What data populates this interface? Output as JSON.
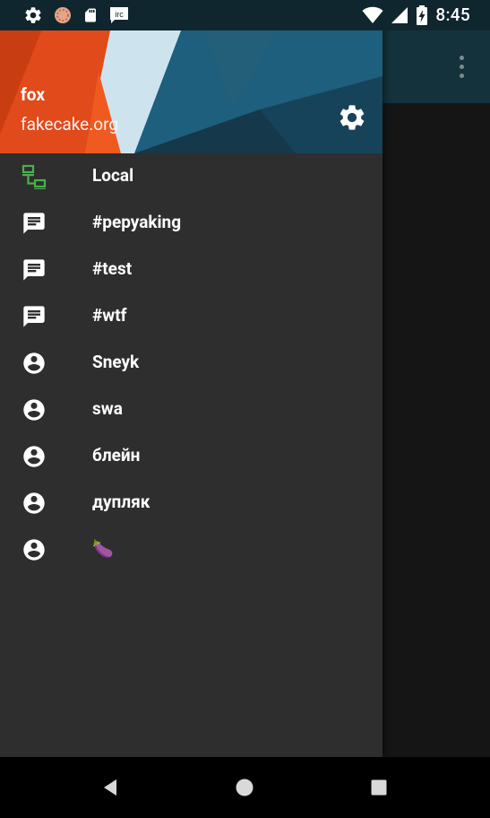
{
  "status_bar": {
    "time": "8:45",
    "left_icons": [
      "gear-icon",
      "hexchat-icon",
      "sd-card-icon",
      "irc-icon"
    ],
    "right_icons": [
      "wifi-icon",
      "cell-signal-icon",
      "battery-charging-icon"
    ],
    "irc_badge": "irc"
  },
  "drawer": {
    "header": {
      "nick": "fox",
      "server": "fakecake.org"
    },
    "items": [
      {
        "label": "Local",
        "icon": "server-network-icon"
      },
      {
        "label": "#pepyaking",
        "icon": "chat-icon"
      },
      {
        "label": "#test",
        "icon": "chat-icon"
      },
      {
        "label": "#wtf",
        "icon": "chat-icon"
      },
      {
        "label": "Sneyk",
        "icon": "account-circle-icon"
      },
      {
        "label": "swa",
        "icon": "account-circle-icon"
      },
      {
        "label": "блейн",
        "icon": "account-circle-icon"
      },
      {
        "label": "дупляк",
        "icon": "account-circle-icon"
      },
      {
        "label": "🍆",
        "icon": "account-circle-icon"
      }
    ]
  },
  "colors": {
    "status_bar": "#10262e",
    "toolbar": "#14323b",
    "drawer_bg": "#2e2e2e",
    "server_icon": "#4caf50",
    "orange": "#e14a1a",
    "pale_blue": "#cde4ef",
    "teal": "#1d5f7c"
  },
  "nav_bar": {
    "buttons": [
      "back-icon",
      "home-icon",
      "recents-icon"
    ]
  }
}
